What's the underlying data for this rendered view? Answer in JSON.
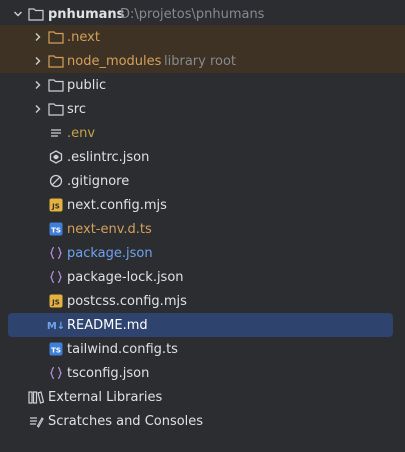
{
  "project": {
    "name": "pnhumans",
    "path": "D:\\projetos\\pnhumans"
  },
  "items": [
    {
      "label": "node_modules",
      "hint": "library root"
    }
  ],
  "tree": {
    "next": ".next",
    "node_modules": "node_modules",
    "node_modules_hint": "library root",
    "public": "public",
    "src": "src",
    "env": ".env",
    "eslintrc": ".eslintrc.json",
    "gitignore": ".gitignore",
    "next_config": "next.config.mjs",
    "next_env": "next-env.d.ts",
    "package": "package.json",
    "package_lock": "package-lock.json",
    "postcss": "postcss.config.mjs",
    "readme": "README.md",
    "tailwind": "tailwind.config.ts",
    "tsconfig": "tsconfig.json",
    "external_libraries": "External Libraries",
    "scratches": "Scratches and Consoles"
  },
  "icons": {
    "js_badge": "JS",
    "ts_badge": "TS",
    "md_badge": "M↓"
  },
  "colors": {
    "background": "#2b2d30",
    "excluded_row": "#3d3223",
    "selected_row": "#2e436e",
    "excluded_text": "#d5a05c",
    "modified_text": "#6fa3ef",
    "hint_text": "#868a91"
  }
}
